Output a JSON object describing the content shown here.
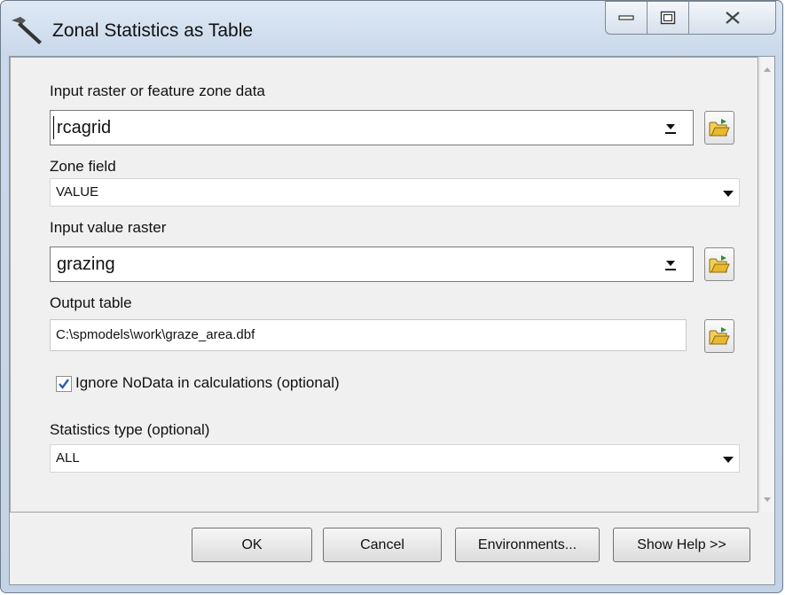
{
  "window": {
    "title": "Zonal Statistics as Table",
    "app_icon": "hammer-icon",
    "controls": [
      "minimize-icon",
      "maximize-icon",
      "close-icon"
    ]
  },
  "form": {
    "zone_data": {
      "label": "Input raster or feature zone data",
      "value": "rcagrid"
    },
    "zone_field": {
      "label": "Zone field",
      "value": "VALUE"
    },
    "value_raster": {
      "label": "Input value raster",
      "value": "grazing"
    },
    "output_table": {
      "label": "Output table",
      "value": "C:\\spmodels\\work\\graze_area.dbf"
    },
    "ignore_nodata": {
      "label": "Ignore NoData in calculations (optional)",
      "checked": true
    },
    "statistics_type": {
      "label": "Statistics type (optional)",
      "value": "ALL"
    }
  },
  "buttons": {
    "ok": "OK",
    "cancel": "Cancel",
    "environments": "Environments...",
    "show_help": "Show Help >>"
  },
  "colors": {
    "accent": "#3a6ea5",
    "folder": "#e8b830",
    "check": "#2a5fb0"
  }
}
